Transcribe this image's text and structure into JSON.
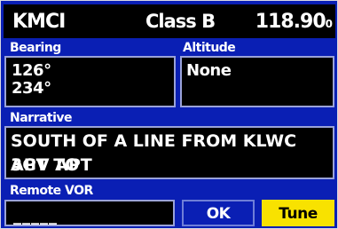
{
  "title": {
    "identifier": "KMCI",
    "airspace_class": "Class B",
    "frequency": "118.90",
    "frequency_suffix": "0"
  },
  "bearing": {
    "label": "Bearing",
    "values": [
      "126°",
      "234°"
    ]
  },
  "altitude": {
    "label": "Altitude",
    "value": "None"
  },
  "narrative": {
    "label": "Narrative",
    "lines": [
      "SOUTH OF A LINE FROM KLWC APT TO",
      "3GV APT"
    ]
  },
  "remote_vor": {
    "label": "Remote VOR",
    "value": "_____"
  },
  "buttons": {
    "ok": "OK",
    "tune": "Tune"
  },
  "colors": {
    "background": "#0a1fb4",
    "field": "#000000",
    "tune_button": "#f8e200"
  }
}
